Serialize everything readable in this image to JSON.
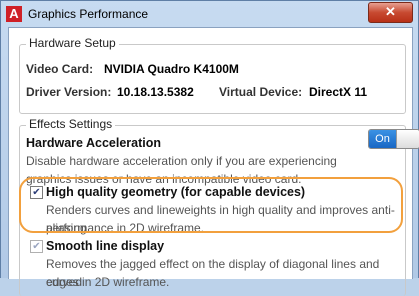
{
  "window": {
    "title": "Graphics Performance",
    "app_icon_letter": "A",
    "close_glyph": "✕"
  },
  "hardware_setup": {
    "group_title": "Hardware Setup",
    "video_card_label": "Video Card:",
    "video_card_value": "NVIDIA Quadro K4100M",
    "driver_version_label": "Driver Version:",
    "driver_version_value": "10.18.13.5382",
    "virtual_device_label": "Virtual Device:",
    "virtual_device_value": "DirectX 11"
  },
  "effects_settings": {
    "group_title": "Effects Settings",
    "hardware_acceleration": {
      "heading": "Hardware Acceleration",
      "description_line1": "Disable hardware acceleration only if you are experiencing",
      "description_line2": "graphics issues or have an incompatible video card.",
      "toggle_label": "On",
      "enabled": true
    },
    "high_quality_geometry": {
      "heading": "High quality geometry (for capable devices)",
      "description_line1": "Renders curves and lineweights in high quality and improves anti-aliasing",
      "description_line2": "performance in 2D wireframe.",
      "checked": true,
      "check_glyph": "✔"
    },
    "smooth_line_display": {
      "heading": "Smooth line display",
      "description_line1": "Removes the jagged effect on the display of diagonal lines and curved",
      "description_line2": "edges in 2D wireframe.",
      "checked": true,
      "check_glyph": "✔"
    }
  },
  "colors": {
    "highlight": "#f2a03d",
    "toggle_on": "#1866c4",
    "close_button": "#c84a31",
    "app_icon": "#cf2027"
  }
}
